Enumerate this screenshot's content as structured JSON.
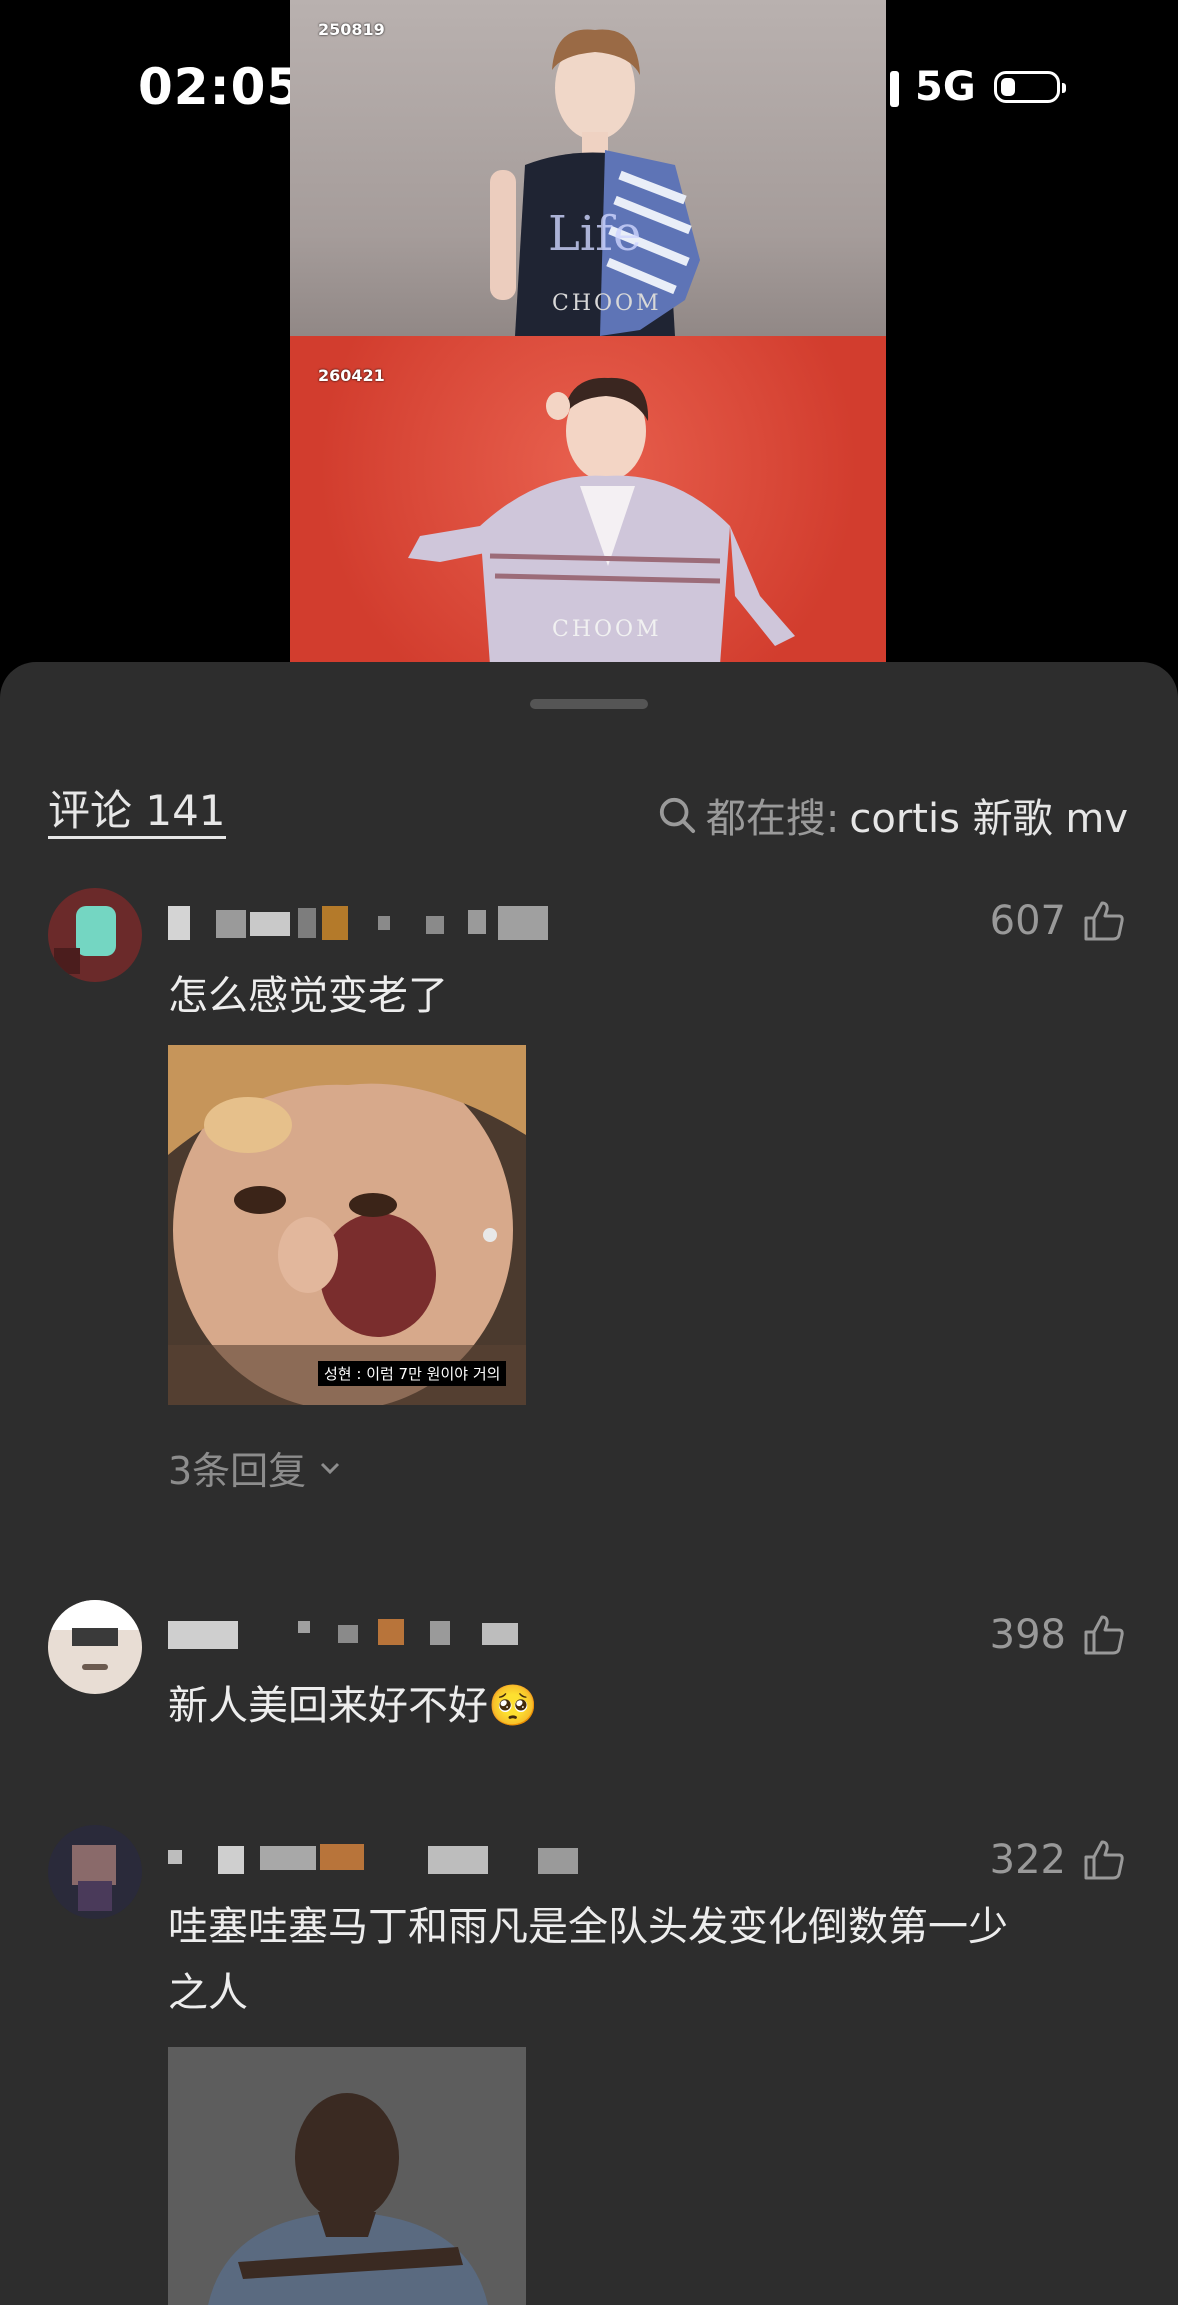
{
  "status_bar": {
    "time": "02:05",
    "network": "5G"
  },
  "video": {
    "stamp_top": "250819",
    "stamp_bottom": "260421"
  },
  "comments_header": {
    "count_label": "评论 141",
    "search_prefix": "都在搜:",
    "search_query": "cortis 新歌 mv"
  },
  "comments": [
    {
      "likes": "607",
      "text": "怎么感觉变老了",
      "image_caption": "성현 : 이럼 7만 원이야 거의",
      "replies": "3条回复"
    },
    {
      "likes": "398",
      "text": "新人美回来好不好🥺"
    },
    {
      "likes": "322",
      "text": "哇塞哇塞马丁和雨凡是全队头发变化倒数第一少",
      "text_cont": "之人"
    }
  ]
}
